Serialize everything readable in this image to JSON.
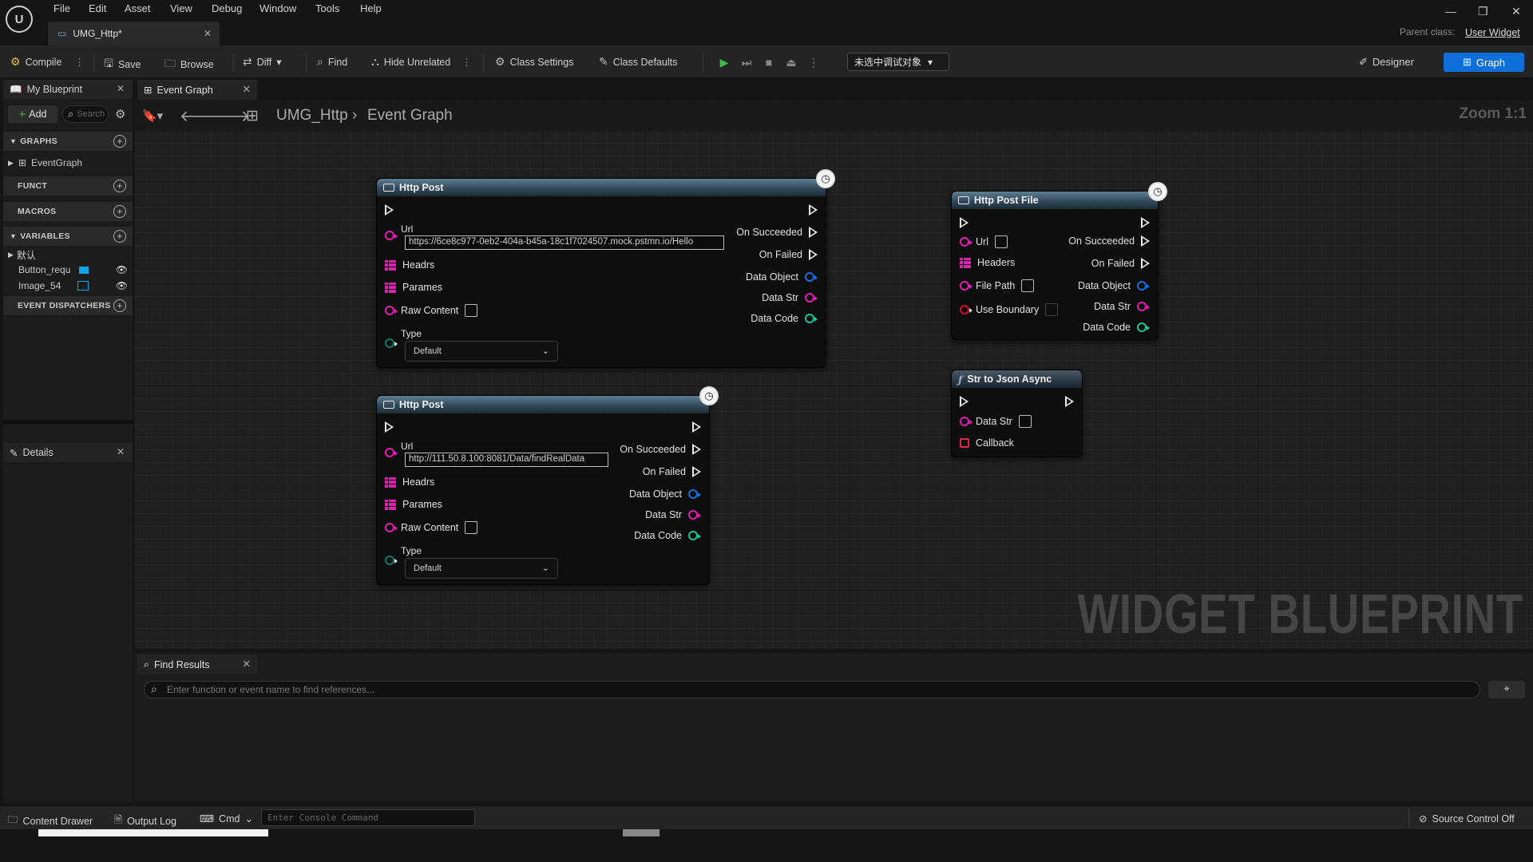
{
  "app": {
    "doc_tab": "UMG_Http*",
    "parent_class_label": "Parent class:",
    "parent_class_value": "User Widget"
  },
  "menu": [
    "File",
    "Edit",
    "Asset",
    "View",
    "Debug",
    "Window",
    "Tools",
    "Help"
  ],
  "toolbar": {
    "compile": "Compile",
    "save": "Save",
    "browse": "Browse",
    "diff": "Diff",
    "find": "Find",
    "hide_unrelated": "Hide Unrelated",
    "class_settings": "Class Settings",
    "class_defaults": "Class Defaults",
    "debug_object": "未选中调试对象",
    "designer": "Designer",
    "graph": "Graph"
  },
  "my_blueprint": {
    "tab": "My Blueprint",
    "add": "Add",
    "search_placeholder": "Search",
    "sections": {
      "graphs": "GRAPHS",
      "functions": "FUNCT",
      "macros": "MACROS",
      "variables": "VARIABLES",
      "event_dispatchers": "EVENT DISPATCHERS"
    },
    "graph_item": "EventGraph",
    "var_category": "默认",
    "variables": [
      "Button_requ",
      "Image_54"
    ]
  },
  "details": {
    "tab": "Details"
  },
  "graph": {
    "tab": "Event Graph",
    "crumb_root": "UMG_Http",
    "crumb_leaf": "Event Graph",
    "zoom": "Zoom 1:1",
    "watermark": "WIDGET BLUEPRINT",
    "node1": {
      "title": "Http Post",
      "url_label": "Url",
      "url_value": "https://6ce8c977-0eb2-404a-b45a-18c1f7024507.mock.pstmn.io/Hello",
      "headrs": "Headrs",
      "parames": "Parames",
      "raw_content": "Raw Content",
      "type_label": "Type",
      "type_value": "Default",
      "on_succeeded": "On Succeeded",
      "on_failed": "On Failed",
      "data_object": "Data Object",
      "data_str": "Data Str",
      "data_code": "Data Code"
    },
    "node2": {
      "title": "Http Post",
      "url_label": "Url",
      "url_value": "http://111.50.8.100:8081/Data/findRealData",
      "headrs": "Headrs",
      "parames": "Parames",
      "raw_content": "Raw Content",
      "type_label": "Type",
      "type_value": "Default",
      "on_succeeded": "On Succeeded",
      "on_failed": "On Failed",
      "data_object": "Data Object",
      "data_str": "Data Str",
      "data_code": "Data Code"
    },
    "node3": {
      "title": "Http Post File",
      "url": "Url",
      "headers": "Headers",
      "file_path": "File Path",
      "use_boundary": "Use Boundary",
      "on_succeeded": "On Succeeded",
      "on_failed": "On Failed",
      "data_object": "Data Object",
      "data_str": "Data Str",
      "data_code": "Data Code"
    },
    "node4": {
      "title": "Str to Json Async",
      "data_str": "Data Str",
      "callback": "Callback"
    }
  },
  "find_results": {
    "tab": "Find Results",
    "placeholder": "Enter function or event name to find references..."
  },
  "statusbar": {
    "content_drawer": "Content Drawer",
    "output_log": "Output Log",
    "cmd": "Cmd",
    "console_placeholder": "Enter Console Command",
    "source_control": "Source Control Off"
  },
  "colors": {
    "accent": "#0e6fd8",
    "exec": "#eeeeee",
    "string_pin": "#e020b0",
    "object_pin": "#1a6fe0",
    "int_pin": "#1fc49a"
  }
}
